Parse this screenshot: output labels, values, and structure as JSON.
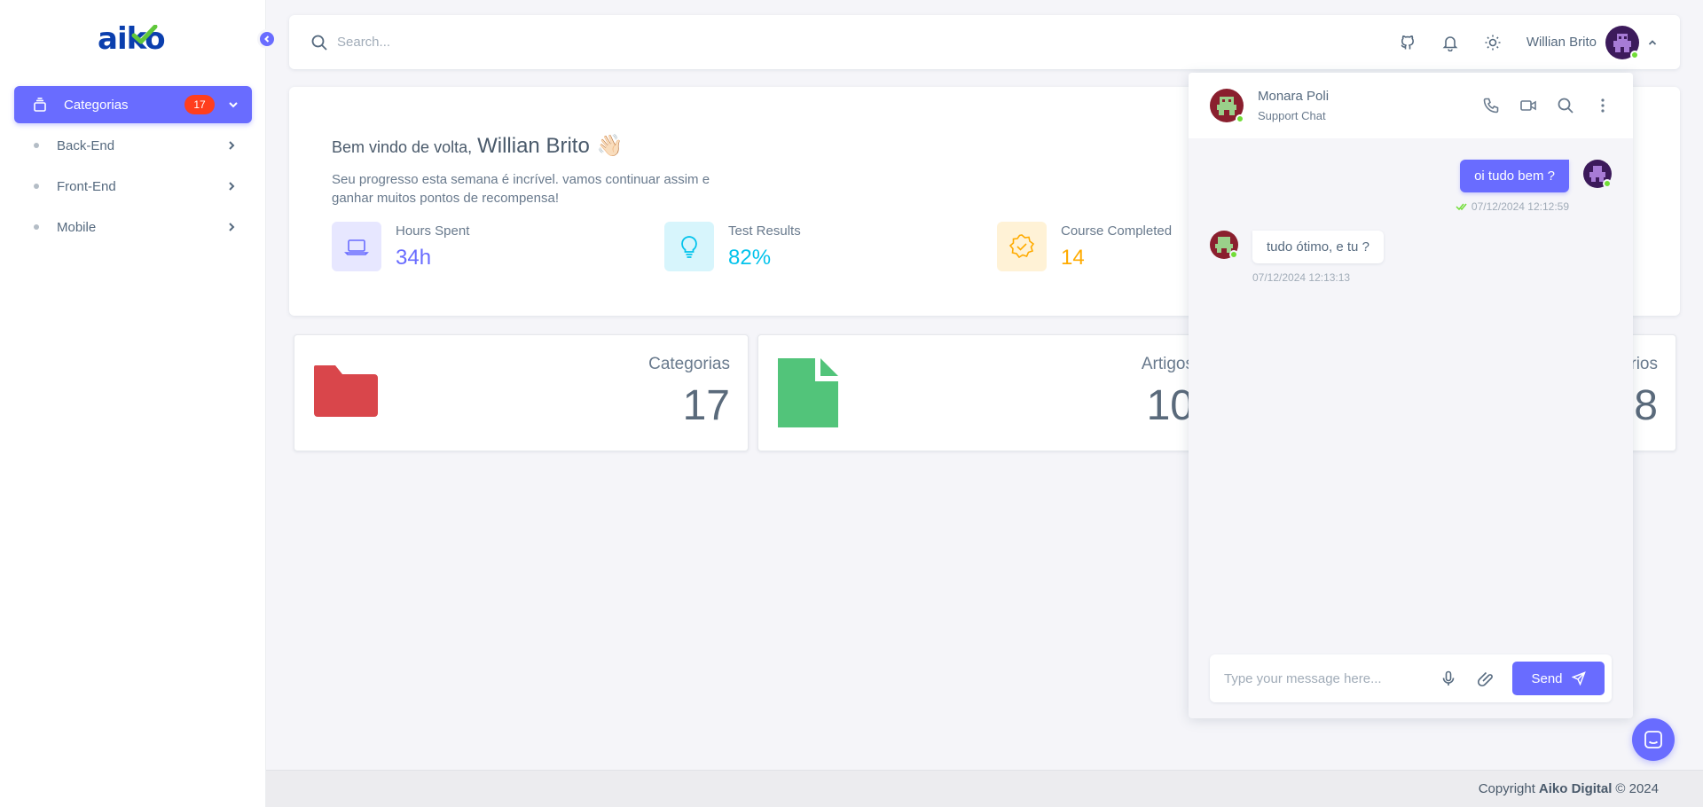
{
  "brand": {
    "logo_text": "aiko"
  },
  "sidebar": {
    "active_item": {
      "label": "Categorias",
      "count": "17",
      "icon": "layers-icon"
    },
    "items": [
      {
        "label": "Back-End"
      },
      {
        "label": "Front-End"
      },
      {
        "label": "Mobile"
      }
    ]
  },
  "topbar": {
    "search_placeholder": "Search...",
    "user_name": "Willian Brito",
    "icons": [
      "github-icon",
      "bell-icon",
      "sun-icon"
    ]
  },
  "welcome": {
    "greeting": "Bem vindo de volta,",
    "name": "Willian Brito",
    "wave": "👋🏻",
    "message": "Seu progresso esta semana é incrível. vamos continuar assim e ganhar muitos pontos de recompensa!",
    "stats": [
      {
        "label": "Hours Spent",
        "value": "34h",
        "color": "#696cff",
        "bg": "#e7e7ff",
        "icon": "laptop-icon"
      },
      {
        "label": "Test Results",
        "value": "82%",
        "color": "#03c3ec",
        "bg": "#d7f5fc",
        "icon": "lightbulb-icon"
      },
      {
        "label": "Course Completed",
        "value": "14",
        "color": "#ffab00",
        "bg": "#fff2d6",
        "icon": "badge-check-icon"
      }
    ]
  },
  "cards": [
    {
      "label": "Categorias",
      "value": "17",
      "icon": "folder-icon",
      "color": "#d9464b"
    },
    {
      "label": "Artigos",
      "value": "10",
      "icon": "file-icon",
      "color": "#52c47a"
    },
    {
      "label": "rios",
      "value": "8"
    }
  ],
  "chat": {
    "contact_name": "Monara Poli",
    "contact_sub": "Support Chat",
    "messages": [
      {
        "direction": "out",
        "text": "oi tudo bem ?",
        "time": "07/12/2024 12:12:59"
      },
      {
        "direction": "in",
        "text": "tudo ótimo, e tu ?",
        "time": "07/12/2024 12:13:13"
      }
    ],
    "input_placeholder": "Type your message here...",
    "send_label": "Send"
  },
  "footer": {
    "prefix": "Copyright",
    "company": "Aiko Digital",
    "suffix": "© 2024"
  },
  "colors": {
    "primary": "#696cff",
    "danger": "#ff3e1d",
    "success": "#71dd37"
  }
}
